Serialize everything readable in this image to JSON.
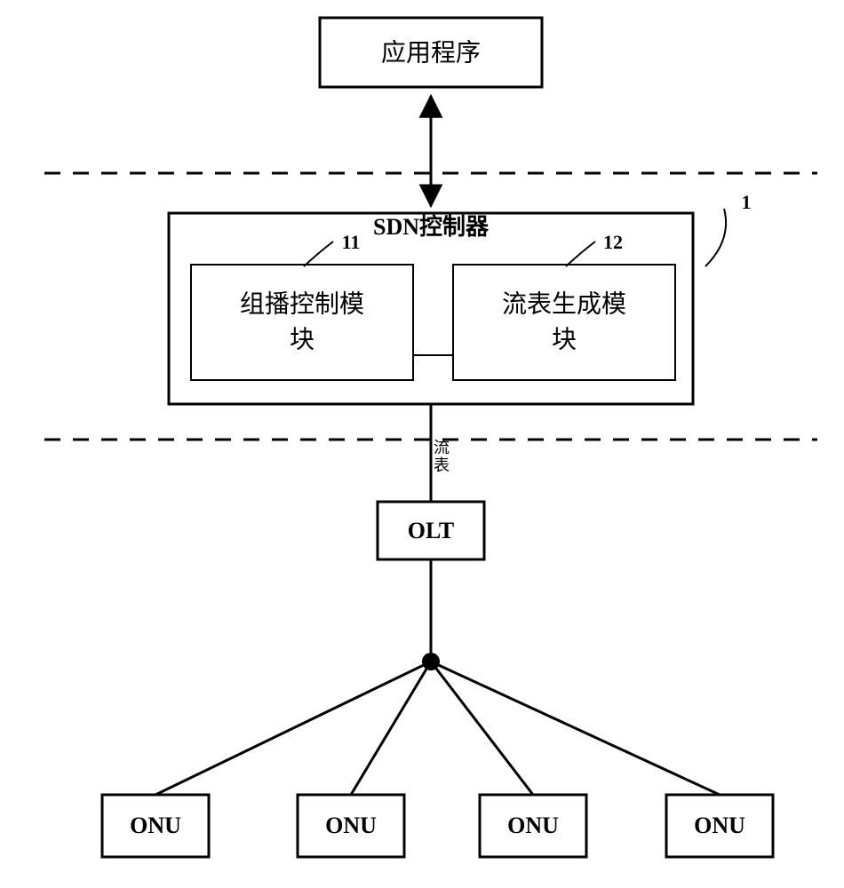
{
  "app_box": {
    "label": "应用程序"
  },
  "controller": {
    "title": "SDN控制器",
    "ref": "1",
    "modules": {
      "left": {
        "num": "11",
        "line1": "组播控制模",
        "line2": "块"
      },
      "right": {
        "num": "12",
        "line1": "流表生成模",
        "line2": "块"
      }
    }
  },
  "flow_label": {
    "c1": "流",
    "c2": "表"
  },
  "olt": {
    "label": "OLT"
  },
  "onus": [
    "ONU",
    "ONU",
    "ONU",
    "ONU"
  ]
}
